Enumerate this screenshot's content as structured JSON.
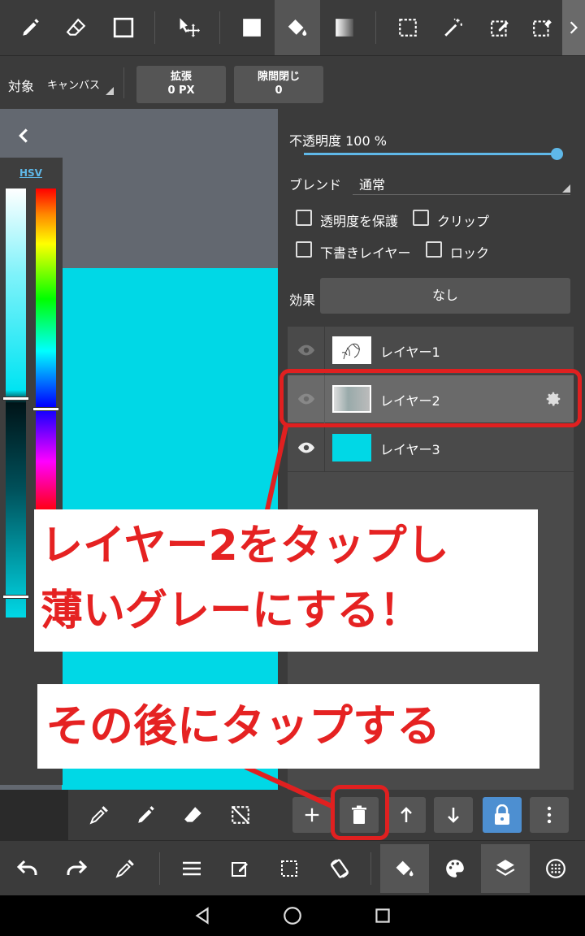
{
  "options_bar": {
    "target_label": "対象",
    "target_value": "キャンバス",
    "expand_label": "拡張",
    "expand_value": "0 PX",
    "gap_close_label": "隙間閉じ",
    "gap_close_value": "0"
  },
  "color_panel": {
    "mode": "HSV"
  },
  "layer_panel": {
    "opacity_label": "不透明度 100 %",
    "opacity_value": 100,
    "blend_label": "ブレンド",
    "blend_value": "通常",
    "protect_alpha": "透明度を保護",
    "clip": "クリップ",
    "draft_layer": "下書きレイヤー",
    "lock": "ロック",
    "effect_label": "効果",
    "effect_value": "なし",
    "layers": [
      {
        "name": "レイヤー1"
      },
      {
        "name": "レイヤー2",
        "selected": true
      },
      {
        "name": "レイヤー3"
      }
    ]
  },
  "annotations": {
    "callout_1_line1": "レイヤー2をタップし",
    "callout_1_line2": "薄いグレーにする！",
    "callout_2": "その後にタップする"
  },
  "colors": {
    "accent_blue": "#5fb8e8",
    "annotation_red": "#e02020",
    "canvas_cyan": "#00d8e6",
    "layer3_color": "#00d8e6"
  }
}
